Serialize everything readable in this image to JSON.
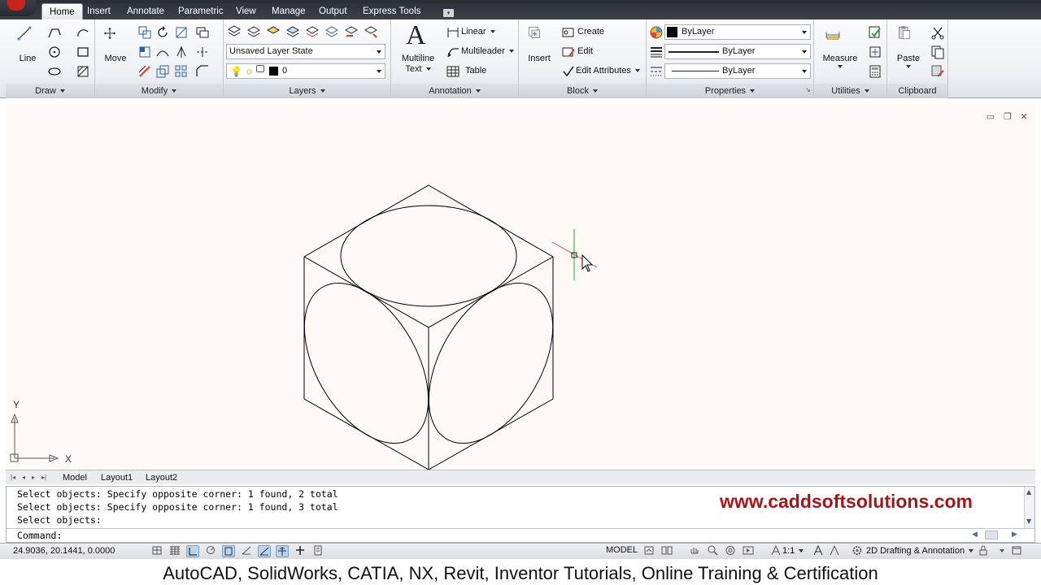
{
  "tabs": [
    "Home",
    "Insert",
    "Annotate",
    "Parametric",
    "View",
    "Manage",
    "Output",
    "Express Tools"
  ],
  "panels": {
    "draw": {
      "footer": "Draw",
      "line_label": "Line"
    },
    "modify": {
      "footer": "Modify",
      "move_label": "Move"
    },
    "layers": {
      "footer": "Layers",
      "layer_state": "Unsaved Layer State",
      "current_layer": "0"
    },
    "annotation": {
      "footer": "Annotation",
      "multiline_text_1": "Multiline",
      "multiline_text_2": "Text",
      "linear": "Linear",
      "multileader": "Multileader",
      "table": "Table"
    },
    "block": {
      "footer": "Block",
      "insert": "Insert",
      "create": "Create",
      "edit": "Edit",
      "edit_attributes": "Edit Attributes"
    },
    "properties": {
      "footer": "Properties",
      "color": "ByLayer",
      "linetype": "ByLayer",
      "lineweight": "ByLayer"
    },
    "utilities": {
      "footer": "Utilities",
      "measure": "Measure"
    },
    "clipboard": {
      "footer": "Clipboard",
      "paste": "Paste"
    }
  },
  "ucs": {
    "x_label": "X",
    "y_label": "Y"
  },
  "layout_tabs": [
    "Model",
    "Layout1",
    "Layout2"
  ],
  "command_history": [
    "Select objects: Specify opposite corner: 1 found, 2 total",
    "Select objects: Specify opposite corner: 1 found, 3 total",
    "Select objects:"
  ],
  "command_prompt": "Command:",
  "watermark": "www.caddsoftsolutions.com",
  "status": {
    "coordinates": "24.9036, 20.1441, 0.0000",
    "model": "MODEL",
    "annotation_scale": "1:1",
    "workspace": "2D Drafting & Annotation"
  },
  "banner": "AutoCAD, SolidWorks, CATIA, NX, Revit, Inventor Tutorials, Online Training & Certification",
  "colors": {
    "ribbon_tab_bar": "#343942",
    "canvas": "#fdfaf6",
    "watermark": "#a5161b",
    "crosshair_x": "#d0445a",
    "crosshair_y": "#2f9a3f"
  }
}
